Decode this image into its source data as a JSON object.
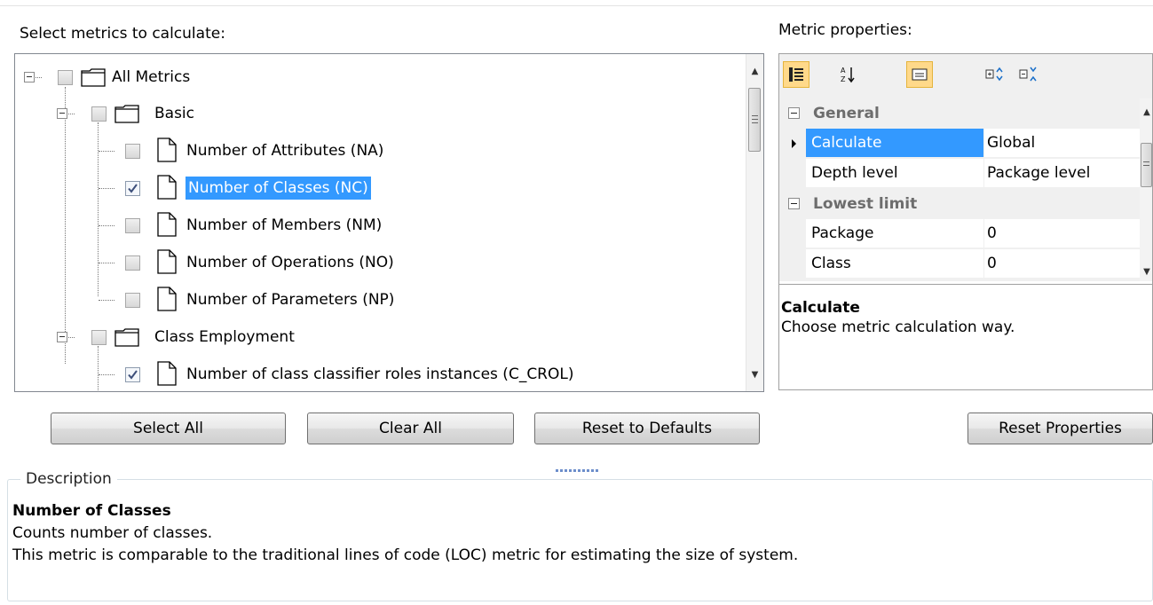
{
  "left_panel": {
    "caption": "Select metrics to calculate:",
    "tree": [
      {
        "label": "All Metrics",
        "type": "folder",
        "checked": false
      },
      {
        "label": "Basic",
        "type": "folder",
        "checked": false
      },
      {
        "label": "Number of Attributes (NA)",
        "type": "metric",
        "checked": false
      },
      {
        "label": "Number of Classes (NC)",
        "type": "metric",
        "checked": true,
        "selected": true
      },
      {
        "label": "Number of Members (NM)",
        "type": "metric",
        "checked": false
      },
      {
        "label": "Number of Operations (NO)",
        "type": "metric",
        "checked": false
      },
      {
        "label": "Number of Parameters (NP)",
        "type": "metric",
        "checked": false
      },
      {
        "label": "Class Employment",
        "type": "folder",
        "checked": false
      },
      {
        "label": "Number of class classifier roles instances (C_CROL)",
        "type": "metric",
        "checked": true
      }
    ]
  },
  "buttons": {
    "select_all": "Select All",
    "clear_all": "Clear All",
    "reset_defaults": "Reset to Defaults",
    "reset_properties": "Reset Properties"
  },
  "right_panel": {
    "caption": "Metric properties:",
    "toolbar_icons": [
      "categorized-icon",
      "alphabetical-icon",
      "property-pages-icon",
      "expand-all-icon",
      "collapse-all-icon"
    ],
    "categories": [
      {
        "name": "General",
        "properties": [
          {
            "name": "Calculate",
            "value": "Global",
            "selected": true
          },
          {
            "name": "Depth level",
            "value": "Package level"
          }
        ]
      },
      {
        "name": "Lowest limit",
        "properties": [
          {
            "name": "Package",
            "value": "0"
          },
          {
            "name": "Class",
            "value": "0"
          }
        ]
      }
    ],
    "help_title": "Calculate",
    "help_text": "Choose metric calculation way."
  },
  "description": {
    "caption": "Description",
    "title": "Number of Classes",
    "line1": "Counts number of classes.",
    "line2": "This metric is comparable to the traditional lines of code (LOC) metric for estimating the size of system."
  },
  "colors": {
    "selection": "#3399ff",
    "toolbar_active": "#ffd98a",
    "splitter_dots": "#6d8ecb"
  }
}
